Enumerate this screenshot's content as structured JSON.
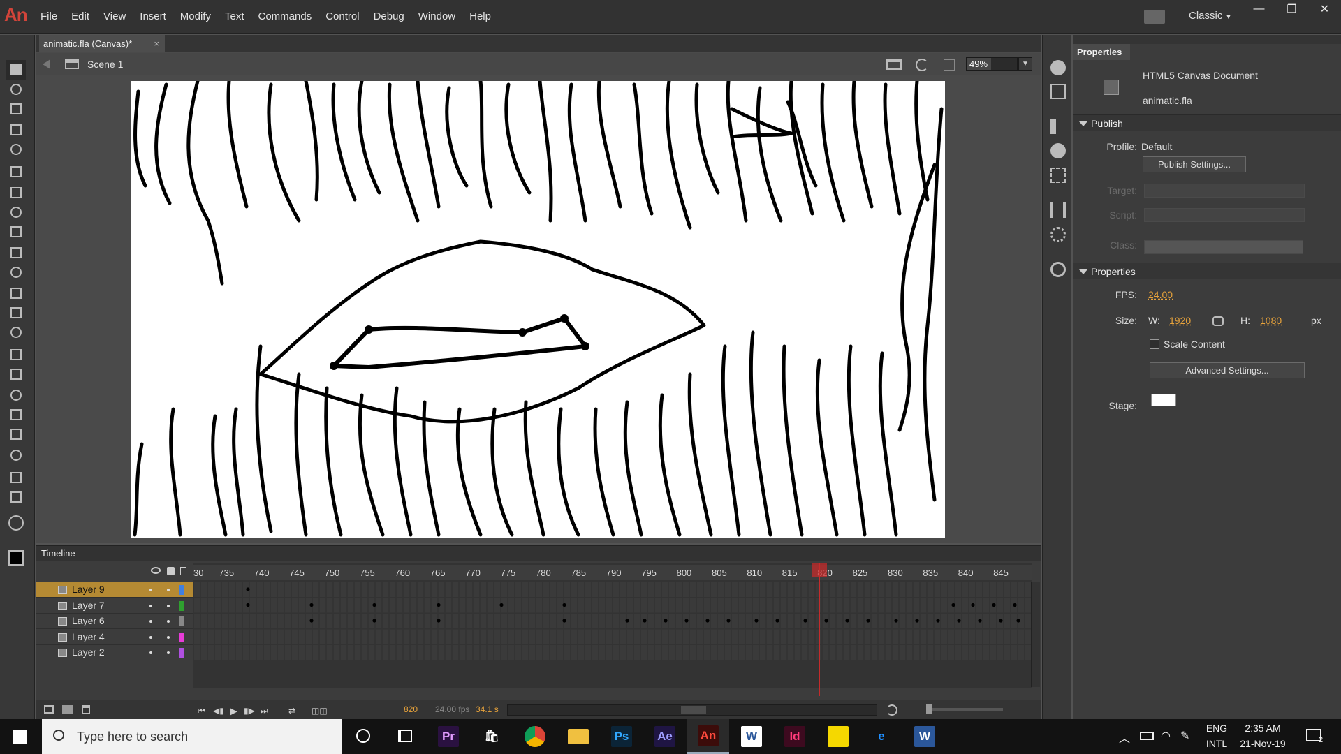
{
  "app": {
    "logo": "An",
    "workspace": "Classic"
  },
  "menu": [
    "File",
    "Edit",
    "View",
    "Insert",
    "Modify",
    "Text",
    "Commands",
    "Control",
    "Debug",
    "Window",
    "Help"
  ],
  "document": {
    "tab_title": "animatic.fla (Canvas)*",
    "scene": "Scene 1",
    "zoom": "49%",
    "zoom_value": 49
  },
  "timeline": {
    "title": "Timeline",
    "ticks": [
      "30",
      "735",
      "740",
      "745",
      "750",
      "755",
      "760",
      "765",
      "770",
      "775",
      "780",
      "785",
      "790",
      "795",
      "800",
      "805",
      "810",
      "815",
      "820",
      "825",
      "830",
      "835",
      "840",
      "845"
    ],
    "layers": [
      {
        "name": "Layer 9",
        "color": "#3f7fe0",
        "selected": true
      },
      {
        "name": "Layer 7",
        "color": "#2fa02f",
        "selected": false
      },
      {
        "name": "Layer 6",
        "color": "#888888",
        "selected": false
      },
      {
        "name": "Layer 4",
        "color": "#e83cd8",
        "selected": false
      },
      {
        "name": "Layer 2",
        "color": "#b050e0",
        "selected": false
      }
    ],
    "current_frame": "820",
    "fps": "24.00 fps",
    "time": "34.1 s"
  },
  "properties": {
    "tab": "Properties",
    "doc_type": "HTML5 Canvas Document",
    "doc_name": "animatic.fla",
    "publish_section": "Publish",
    "profile_label": "Profile:",
    "profile_value": "Default",
    "publish_settings": "Publish Settings...",
    "target_label": "Target:",
    "script_label": "Script:",
    "class_label": "Class:",
    "props_section": "Properties",
    "fps_label": "FPS:",
    "fps_value": "24.00",
    "size_label": "Size:",
    "w_label": "W:",
    "w_value": "1920",
    "h_label": "H:",
    "h_value": "1080",
    "unit": "px",
    "scale_content": "Scale Content",
    "advanced_settings": "Advanced Settings...",
    "stage_label": "Stage:",
    "stage_color": "#ffffff"
  },
  "taskbar": {
    "search_placeholder": "Type here to search",
    "apps": [
      {
        "name": "premiere",
        "label": "Pr",
        "bg": "#2a1140",
        "fg": "#e39cff"
      },
      {
        "name": "store",
        "label": "🛍",
        "bg": "transparent",
        "fg": "#fff"
      },
      {
        "name": "chrome",
        "label": "",
        "bg": "transparent",
        "fg": "#fff"
      },
      {
        "name": "explorer",
        "label": "",
        "bg": "transparent",
        "fg": "#fff"
      },
      {
        "name": "photoshop",
        "label": "Ps",
        "bg": "#0b2437",
        "fg": "#31a8ff"
      },
      {
        "name": "after-effects",
        "label": "Ae",
        "bg": "#1f1543",
        "fg": "#9d9dff"
      },
      {
        "name": "animate",
        "label": "An",
        "bg": "#3c0c0a",
        "fg": "#ff4a3d"
      },
      {
        "name": "word-online",
        "label": "W",
        "bg": "#ffffff",
        "fg": "#2b579a"
      },
      {
        "name": "indesign",
        "label": "Id",
        "bg": "#3d0a1f",
        "fg": "#ff3b7a"
      },
      {
        "name": "sticky-notes",
        "label": "",
        "bg": "#f5d800",
        "fg": "#000"
      },
      {
        "name": "edge",
        "label": "e",
        "bg": "transparent",
        "fg": "#1f8fff"
      },
      {
        "name": "word",
        "label": "W",
        "bg": "#2b579a",
        "fg": "#ffffff"
      }
    ],
    "lang1": "ENG",
    "lang2": "INTL",
    "time": "2:35 AM",
    "date": "21-Nov-19",
    "notif_count": "2"
  }
}
